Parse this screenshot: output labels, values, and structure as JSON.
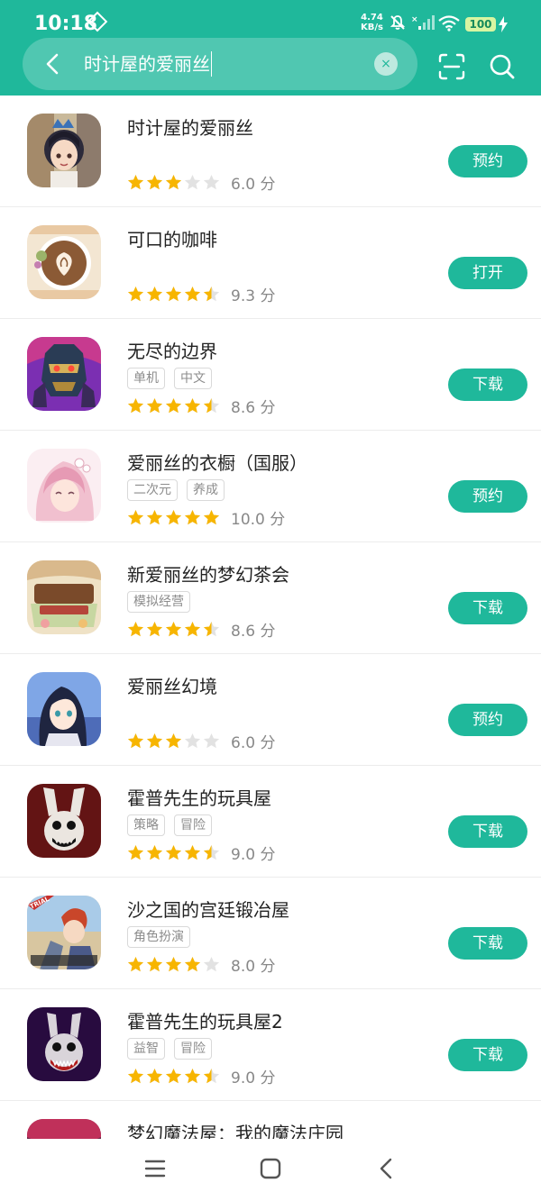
{
  "status_bar": {
    "time": "10:18",
    "net_speed": "4.74",
    "net_unit": "KB/s",
    "battery": "100"
  },
  "search": {
    "query": "时计屋的爱丽丝",
    "clear_symbol": "×"
  },
  "colors": {
    "accent": "#1fb89b",
    "star_on": "#f7b500",
    "star_off": "#e2e2e2"
  },
  "results": [
    {
      "title": "时计屋的爱丽丝",
      "tags": [],
      "stars": [
        1,
        1,
        1,
        0,
        0
      ],
      "score": "6.0 分",
      "action": "预约",
      "icon": "clock-house-alice-icon"
    },
    {
      "title": "可口的咖啡",
      "tags": [],
      "stars": [
        1,
        1,
        1,
        1,
        0.5
      ],
      "score": "9.3 分",
      "action": "打开",
      "icon": "latte-coffee-icon"
    },
    {
      "title": "无尽的边界",
      "tags": [
        "单机",
        "中文"
      ],
      "stars": [
        1,
        1,
        1,
        1,
        0.5
      ],
      "score": "8.6 分",
      "action": "下载",
      "icon": "robot-warrior-icon"
    },
    {
      "title": "爱丽丝的衣橱（国服）",
      "tags": [
        "二次元",
        "养成"
      ],
      "stars": [
        1,
        1,
        1,
        1,
        1
      ],
      "score": "10.0 分",
      "action": "预约",
      "icon": "anime-girl-pink-icon"
    },
    {
      "title": "新爱丽丝的梦幻茶会",
      "tags": [
        "模拟经营"
      ],
      "stars": [
        1,
        1,
        1,
        1,
        0.5
      ],
      "score": "8.6 分",
      "action": "下载",
      "icon": "alices-mad-tea-party-icon"
    },
    {
      "title": "爱丽丝幻境",
      "tags": [],
      "stars": [
        1,
        1,
        1,
        0,
        0
      ],
      "score": "6.0 分",
      "action": "预约",
      "icon": "anime-boy-dark-hair-icon"
    },
    {
      "title": "霍普先生的玩具屋",
      "tags": [
        "策略",
        "冒险"
      ],
      "stars": [
        1,
        1,
        1,
        1,
        0.5
      ],
      "score": "9.0 分",
      "action": "下载",
      "icon": "creepy-rabbit-icon"
    },
    {
      "title": "沙之国的宫廷锻冶屋",
      "tags": [
        "角色扮演"
      ],
      "stars": [
        1,
        1,
        1,
        1,
        0
      ],
      "score": "8.0 分",
      "action": "下载",
      "icon": "blacksmith-sand-kingdom-icon"
    },
    {
      "title": "霍普先生的玩具屋2",
      "tags": [
        "益智",
        "冒险"
      ],
      "stars": [
        1,
        1,
        1,
        1,
        0.5
      ],
      "score": "9.0 分",
      "action": "下载",
      "icon": "creepy-rabbit-2-icon"
    },
    {
      "title": "梦幻魔法屋：我的魔法庄园",
      "tags": [],
      "stars": [],
      "score": "",
      "action": "",
      "icon": "magic-house-icon"
    }
  ],
  "nav": {
    "menu_icon": "menu-icon",
    "home_icon": "home-square-icon",
    "back_icon": "back-triangle-icon"
  }
}
